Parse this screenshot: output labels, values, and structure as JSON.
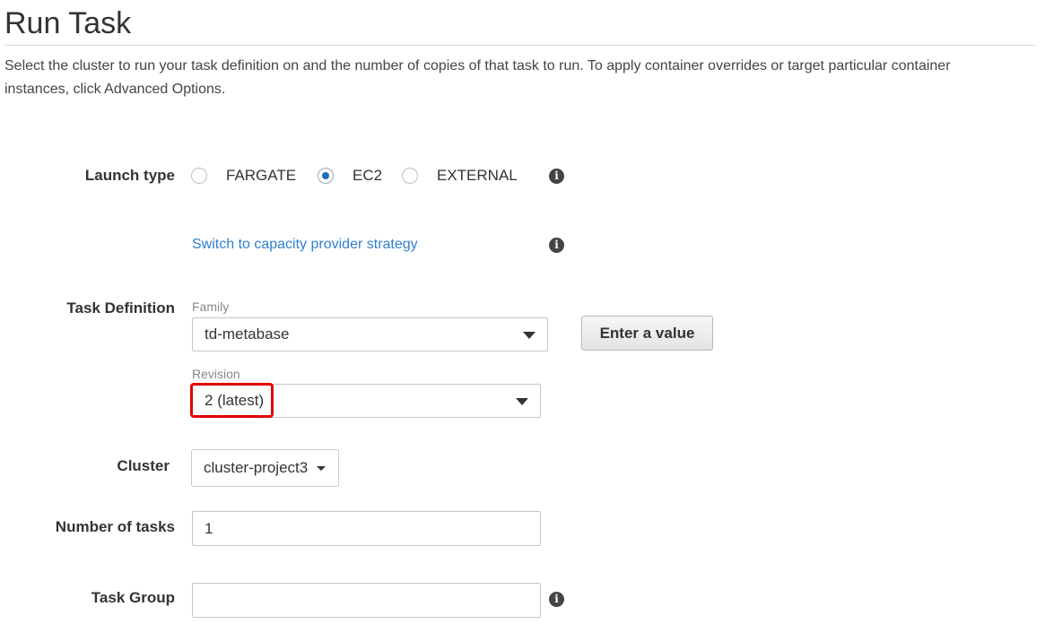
{
  "header": {
    "title": "Run Task",
    "description": "Select the cluster to run your task definition on and the number of copies of that task to run. To apply container overrides or target particular container instances, click Advanced Options."
  },
  "launch_type": {
    "label": "Launch type",
    "options": [
      "FARGATE",
      "EC2",
      "EXTERNAL"
    ],
    "selected": "EC2"
  },
  "capacity_link": "Switch to capacity provider strategy",
  "task_definition": {
    "label": "Task Definition",
    "family_label": "Family",
    "family_value": "td-metabase",
    "enter_value_button": "Enter a value",
    "revision_label": "Revision",
    "revision_value": "2 (latest)"
  },
  "cluster": {
    "label": "Cluster",
    "value": "cluster-project3"
  },
  "number_of_tasks": {
    "label": "Number of tasks",
    "value": "1"
  },
  "task_group": {
    "label": "Task Group",
    "value": ""
  },
  "icons": {
    "info": "i"
  },
  "colors": {
    "link": "#2f7fd1",
    "highlight": "#e00000",
    "radio_selected": "#1f6fb2"
  }
}
